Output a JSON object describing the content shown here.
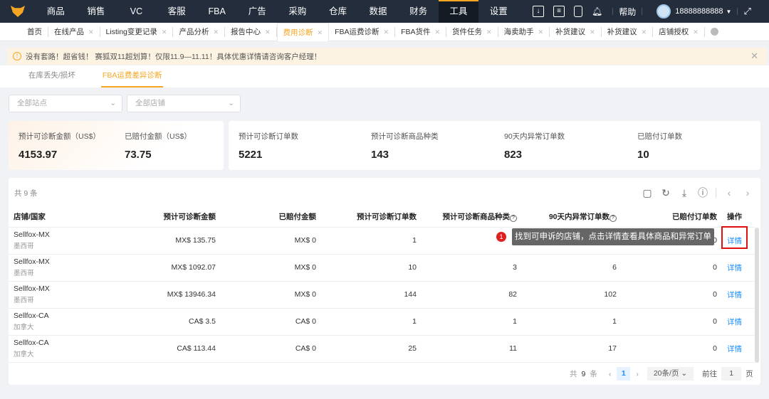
{
  "nav": {
    "items": [
      "商品",
      "销售",
      "VC",
      "客服",
      "FBA",
      "广告",
      "采购",
      "仓库",
      "数据",
      "财务",
      "工具",
      "设置"
    ],
    "active": "工具",
    "help": "帮助",
    "user": "18888888888"
  },
  "tabs": [
    {
      "label": "首页"
    },
    {
      "label": "在线产品"
    },
    {
      "label": "Listing变更记录"
    },
    {
      "label": "产品分析"
    },
    {
      "label": "报告中心"
    },
    {
      "label": "费用诊断",
      "active": true
    },
    {
      "label": "FBA运费诊断"
    },
    {
      "label": "FBA货件"
    },
    {
      "label": "货件任务"
    },
    {
      "label": "海卖助手"
    },
    {
      "label": "补货建议"
    },
    {
      "label": "补货建议"
    },
    {
      "label": "店铺授权"
    }
  ],
  "notice": "没有套路！超省钱！ 赛狐双11超划算！仅限11.9—11.11！具体优惠详情请咨询客户经理！",
  "subtabs": [
    "在库丢失/损坏",
    "FBA运费差异诊断"
  ],
  "filters": {
    "site": "全部站点",
    "shop": "全部店铺"
  },
  "stats": [
    {
      "label": "预计可诊断金额（US$）",
      "value": "4153.97"
    },
    {
      "label": "已赔付金额（US$）",
      "value": "73.75"
    },
    {
      "label": "预计可诊断订单数",
      "value": "5221"
    },
    {
      "label": "预计可诊断商品种类",
      "value": "143"
    },
    {
      "label": "90天内异常订单数",
      "value": "823"
    },
    {
      "label": "已赔付订单数",
      "value": "10"
    }
  ],
  "table": {
    "total": "共 9 条",
    "columns": [
      "店铺/国家",
      "预计可诊断金额",
      "已赔付金额",
      "预计可诊断订单数",
      "预计可诊断商品种类",
      "90天内异常订单数",
      "已赔付订单数",
      "操作"
    ],
    "rows": [
      {
        "shop": "Sellfox-MX",
        "country": "墨西哥",
        "amount": "MX$ 135.75",
        "paid": "MX$ 0",
        "orders": "1",
        "types": "1",
        "abnormal": "1",
        "paid_orders": "0",
        "action": "详情"
      },
      {
        "shop": "Sellfox-MX",
        "country": "墨西哥",
        "amount": "MX$ 1092.07",
        "paid": "MX$ 0",
        "orders": "10",
        "types": "3",
        "abnormal": "6",
        "paid_orders": "0",
        "action": "详情"
      },
      {
        "shop": "Sellfox-MX",
        "country": "墨西哥",
        "amount": "MX$ 13946.34",
        "paid": "MX$ 0",
        "orders": "144",
        "types": "82",
        "abnormal": "102",
        "paid_orders": "0",
        "action": "详情"
      },
      {
        "shop": "Sellfox-CA",
        "country": "加拿大",
        "amount": "CA$ 3.5",
        "paid": "CA$ 0",
        "orders": "1",
        "types": "1",
        "abnormal": "1",
        "paid_orders": "0",
        "action": "详情"
      },
      {
        "shop": "Sellfox-CA",
        "country": "加拿大",
        "amount": "CA$ 113.44",
        "paid": "CA$ 0",
        "orders": "25",
        "types": "11",
        "abnormal": "17",
        "paid_orders": "0",
        "action": "详情"
      }
    ]
  },
  "tooltip": {
    "badge": "1",
    "text": "找到可申诉的店铺，点击详情查看具体商品和异常订单"
  },
  "pager": {
    "total_prefix": "共",
    "total": "9",
    "total_suffix": "条",
    "current": "1",
    "page_size": "20条/页",
    "goto": "前往",
    "goto_value": "1",
    "page_unit": "页"
  }
}
